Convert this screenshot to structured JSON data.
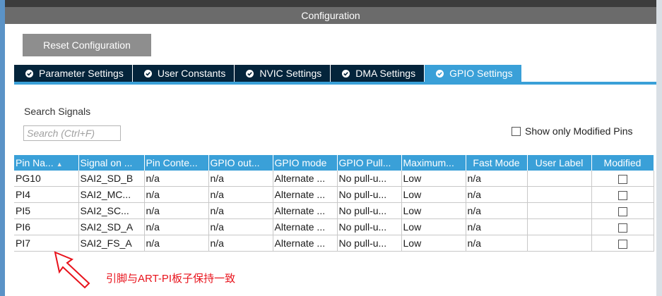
{
  "header": {
    "title": "Configuration"
  },
  "toolbar": {
    "reset_label": "Reset Configuration"
  },
  "tabs": [
    {
      "label": "Parameter Settings",
      "active": false
    },
    {
      "label": "User Constants",
      "active": false
    },
    {
      "label": "NVIC Settings",
      "active": false
    },
    {
      "label": "DMA Settings",
      "active": false
    },
    {
      "label": "GPIO Settings",
      "active": true
    }
  ],
  "search": {
    "title": "Search Signals",
    "placeholder": "Search (Ctrl+F)",
    "value": ""
  },
  "filter": {
    "label": "Show only Modified Pins",
    "checked": false
  },
  "table": {
    "columns": [
      "Pin Na...",
      "Signal on ...",
      "Pin Conte...",
      "GPIO out...",
      "GPIO mode",
      "GPIO Pull...",
      "Maximum...",
      "Fast Mode",
      "User Label",
      "Modified"
    ],
    "rows": [
      [
        "PG10",
        "SAI2_SD_B",
        "n/a",
        "n/a",
        "Alternate ...",
        "No pull-u...",
        "Low",
        "n/a",
        ""
      ],
      [
        "PI4",
        "SAI2_MC...",
        "n/a",
        "n/a",
        "Alternate ...",
        "No pull-u...",
        "Low",
        "n/a",
        ""
      ],
      [
        "PI5",
        "SAI2_SC...",
        "n/a",
        "n/a",
        "Alternate ...",
        "No pull-u...",
        "Low",
        "n/a",
        ""
      ],
      [
        "PI6",
        "SAI2_SD_A",
        "n/a",
        "n/a",
        "Alternate ...",
        "No pull-u...",
        "Low",
        "n/a",
        ""
      ],
      [
        "PI7",
        "SAI2_FS_A",
        "n/a",
        "n/a",
        "Alternate ...",
        "No pull-u...",
        "Low",
        "n/a",
        ""
      ]
    ]
  },
  "annotation": {
    "text": "引脚与ART-PI板子保持一致",
    "color": "#e8121b",
    "icon": "arrow-icon"
  },
  "colors": {
    "accent": "#3aa0d8",
    "tab_dark": "#04243b",
    "header_gray": "#6b6b6b",
    "button_gray": "#8e8e8e"
  }
}
